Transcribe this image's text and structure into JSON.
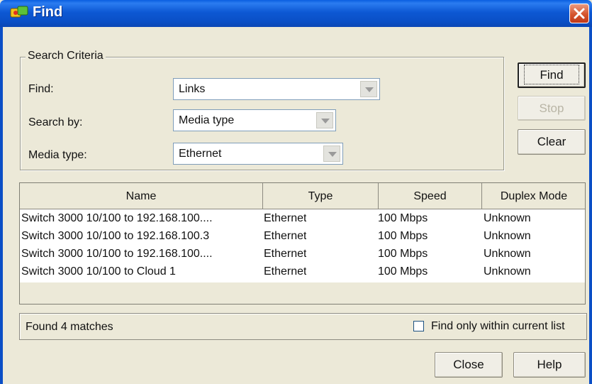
{
  "window": {
    "title": "Find"
  },
  "search_criteria": {
    "legend": "Search Criteria",
    "find_label": "Find:",
    "find_value": "Links",
    "search_by_label": "Search by:",
    "search_by_value": "Media type",
    "media_type_label": "Media type:",
    "media_type_value": "Ethernet"
  },
  "buttons": {
    "find": "Find",
    "stop": "Stop",
    "clear": "Clear",
    "close": "Close",
    "help": "Help"
  },
  "table": {
    "columns": [
      "Name",
      "Type",
      "Speed",
      "Duplex Mode"
    ],
    "rows": [
      [
        "Switch 3000 10/100 to 192.168.100....",
        "Ethernet",
        "100 Mbps",
        "Unknown"
      ],
      [
        "Switch 3000 10/100 to 192.168.100.3",
        "Ethernet",
        "100 Mbps",
        "Unknown"
      ],
      [
        "Switch 3000 10/100 to 192.168.100....",
        "Ethernet",
        "100 Mbps",
        "Unknown"
      ],
      [
        "Switch 3000 10/100 to Cloud 1",
        "Ethernet",
        "100 Mbps",
        "Unknown"
      ]
    ]
  },
  "status": {
    "matches_text": "Found 4 matches",
    "filter_checkbox_label": "Find only within current list",
    "filter_checked": false
  },
  "icons": {
    "app": "find-app-icon",
    "close": "close-icon",
    "dropdown": "chevron-down-icon"
  }
}
